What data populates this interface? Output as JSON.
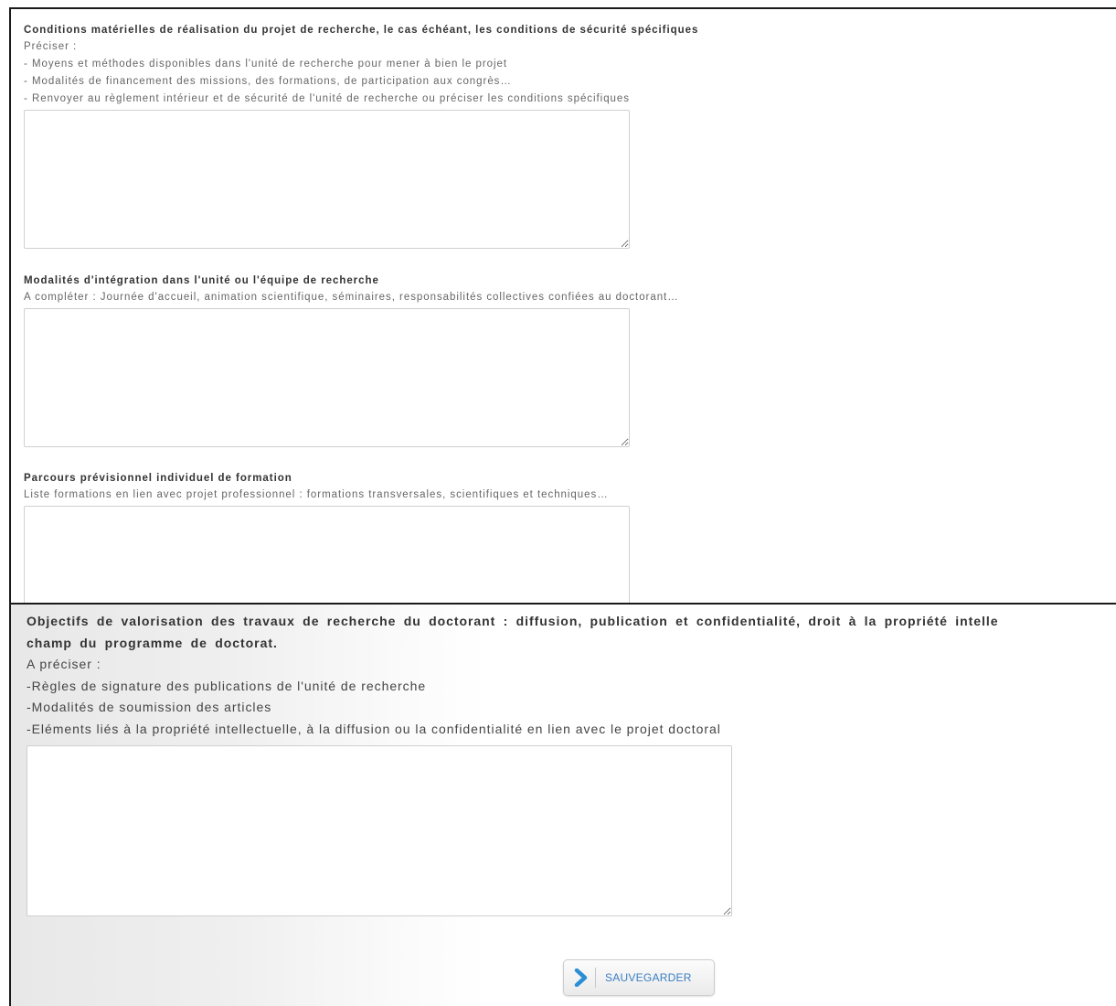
{
  "sections": [
    {
      "title": "Conditions matérielles de réalisation du projet de recherche, le cas échéant, les conditions de sécurité spécifiques",
      "lines": [
        "Préciser :",
        "- Moyens et méthodes disponibles dans l'unité de recherche pour mener à bien le projet",
        "- Modalités de financement des missions, des formations, de participation aux congrès…",
        "- Renvoyer au règlement intérieur et de sécurité de l'unité de recherche ou préciser les conditions spécifiques"
      ],
      "value": ""
    },
    {
      "title": "Modalités d'intégration dans l'unité ou l'équipe de recherche",
      "lines": [
        "A compléter : Journée d'accueil, animation scientifique, séminaires, responsabilités collectives confiées au doctorant…"
      ],
      "value": ""
    },
    {
      "title": "Parcours prévisionnel individuel de formation",
      "lines": [
        "Liste formations en lien avec projet professionnel : formations transversales, scientifiques et techniques…"
      ],
      "value": ""
    }
  ],
  "bottom_section": {
    "title_line1": "Objectifs de valorisation des travaux de recherche du doctorant : diffusion, publication et confidentialité, droit à la propriété intelle",
    "title_line2": "champ du programme de doctorat.",
    "lines": [
      "A préciser :",
      "-Règles de signature des publications de l'unité de recherche",
      "-Modalités de soumission des articles",
      "-Eléments liés à la propriété intellectuelle, à la diffusion ou la confidentialité en lien avec le projet doctoral"
    ],
    "value": ""
  },
  "save_button": {
    "label": "SAUVEGARDER",
    "icon": "chevron-right-icon",
    "icon_color": "#2a8fd4",
    "label_color": "#3b7fc4"
  }
}
